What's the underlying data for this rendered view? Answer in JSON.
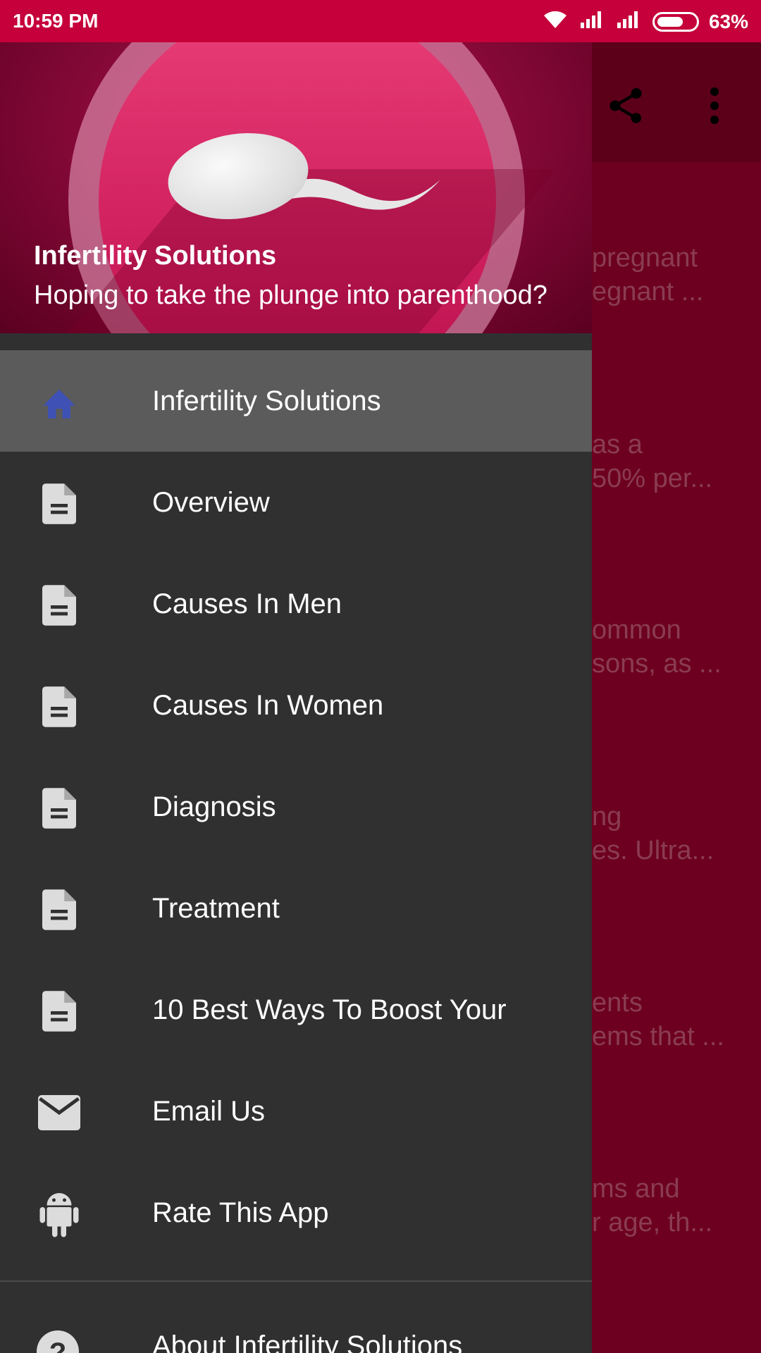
{
  "status_bar": {
    "time": "10:59 PM",
    "battery": "63%"
  },
  "background_app": {
    "toolbar": {
      "share_icon": "share-icon",
      "more_icon": "more-vert-icon"
    },
    "list_items": [
      {
        "line1": "pregnant",
        "line2": "egnant ..."
      },
      {
        "line1": "as a",
        "line2": "50% per..."
      },
      {
        "line1": "ommon",
        "line2": "sons, as ..."
      },
      {
        "line1": "ng",
        "line2": "es. Ultra..."
      },
      {
        "line1": "ents",
        "line2": "ems that ..."
      },
      {
        "line1": "ms and",
        "line2": "r age, th..."
      }
    ]
  },
  "drawer": {
    "header": {
      "title": "Infertility Solutions",
      "subtitle": "Hoping to take the plunge into parenthood?"
    },
    "items": [
      {
        "label": "Infertility Solutions",
        "icon": "home-icon",
        "selected": true
      },
      {
        "label": "Overview",
        "icon": "document-icon"
      },
      {
        "label": "Causes In Men",
        "icon": "document-icon"
      },
      {
        "label": "Causes In Women",
        "icon": "document-icon"
      },
      {
        "label": "Diagnosis",
        "icon": "document-icon"
      },
      {
        "label": "Treatment",
        "icon": "document-icon"
      },
      {
        "label": "10 Best Ways To Boost Your",
        "icon": "document-icon"
      },
      {
        "label": "Email Us",
        "icon": "email-icon"
      },
      {
        "label": "Rate This App",
        "icon": "android-icon"
      }
    ],
    "footer_item": {
      "label": "About Infertility Solutions",
      "icon": "help-icon"
    }
  },
  "colors": {
    "accent": "#c5003a",
    "drawer_bg": "#303030",
    "selected_bg": "#5b5b5b",
    "home_icon": "#3f51b5"
  }
}
